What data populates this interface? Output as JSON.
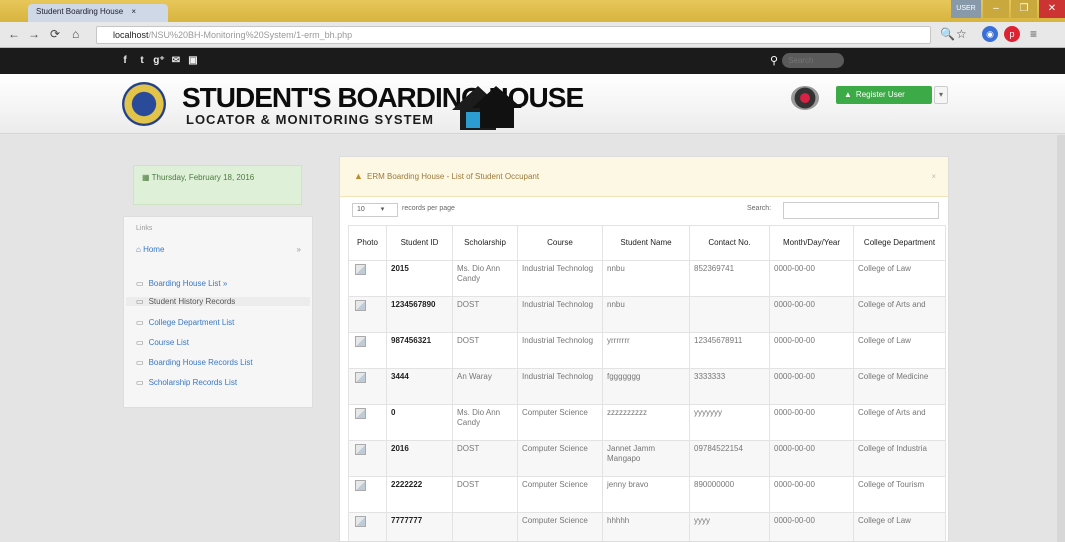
{
  "browser": {
    "tab_title": "Student Boarding House",
    "url_main": "localhost",
    "url_rest": "/NSU%20BH-Monitoring%20System/1-erm_bh.php",
    "window_controls": {
      "account": "USER",
      "minimize": "–",
      "maximize": "❐",
      "close": "✕"
    }
  },
  "topbar": {
    "social": [
      "f",
      "t",
      "g⁺",
      "✉",
      "▣"
    ],
    "search_placeholder": "Search"
  },
  "header": {
    "brand_title": "STUDENT'S BOARDING HOUSE",
    "brand_subtitle": "LOCATOR & MONITORING SYSTEM",
    "register_label": "Register User",
    "caret": "▾"
  },
  "sidebar": {
    "date_text": "Thursday, February 18, 2016",
    "links_title": "Links",
    "home_label": "Home",
    "home_chevron": "»",
    "items": [
      {
        "label": "Boarding House List »"
      },
      {
        "label": "Student History Records"
      },
      {
        "label": "College Department List"
      },
      {
        "label": "Course List"
      },
      {
        "label": "Boarding House Records List"
      },
      {
        "label": "Scholarship Records List"
      }
    ]
  },
  "panel": {
    "title": "ERM Boarding House - List of Student Occupant",
    "close": "×",
    "page_length": "10",
    "length_label": "records per page",
    "search_label": "Search:"
  },
  "table": {
    "headers": [
      "Photo",
      "Student ID",
      "Scholarship",
      "Course",
      "Student Name",
      "Contact No.",
      "Month/Day/Year",
      "College Department"
    ],
    "rows": [
      {
        "student_id": "2015",
        "scholarship": "Ms. Dio Ann Candy",
        "course": "Industrial Technolog",
        "name": "nnbu",
        "contact": "852369741",
        "date": "0000-00-00",
        "department": "College of Law"
      },
      {
        "student_id": "1234567890",
        "scholarship": "DOST",
        "course": "Industrial Technolog",
        "name": "nnbu",
        "contact": "",
        "date": "0000-00-00",
        "department": "College of Arts and"
      },
      {
        "student_id": "987456321",
        "scholarship": "DOST",
        "course": "Industrial Technolog",
        "name": "yrrrrrrr",
        "contact": "12345678911",
        "date": "0000-00-00",
        "department": "College of Law"
      },
      {
        "student_id": "3444",
        "scholarship": "An Waray",
        "course": "Industrial Technolog",
        "name": "fggggggg",
        "contact": "3333333",
        "date": "0000-00-00",
        "department": "College of Medicine"
      },
      {
        "student_id": "0",
        "scholarship": "Ms. Dio Ann Candy",
        "course": "Computer Science",
        "name": "zzzzzzzzzz",
        "contact": "yyyyyyy",
        "date": "0000-00-00",
        "department": "College of Arts and"
      },
      {
        "student_id": "2016",
        "scholarship": "DOST",
        "course": "Computer Science",
        "name": "Jannet Jamm Mangapo",
        "contact": "09784522154",
        "date": "0000-00-00",
        "department": "College of Industria"
      },
      {
        "student_id": "2222222",
        "scholarship": "DOST",
        "course": "Computer Science",
        "name": "jenny bravo",
        "contact": "890000000",
        "date": "0000-00-00",
        "department": "College of Tourism"
      },
      {
        "student_id": "7777777",
        "scholarship": "",
        "course": "Computer Science",
        "name": "hhhhh",
        "contact": "yyyy",
        "date": "0000-00-00",
        "department": "College of Law"
      }
    ]
  },
  "colors": {
    "topbar": "#1b1b1b",
    "register_button": "#3cab47",
    "link": "#3b78c3",
    "date_box": "#dff0d8",
    "panel_heading": "#fcf8e3"
  }
}
